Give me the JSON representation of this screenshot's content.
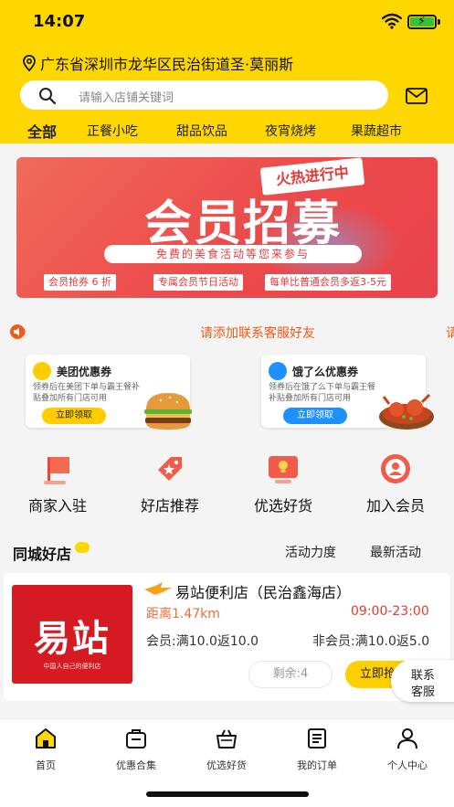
{
  "status_bar": {
    "time": "14:07"
  },
  "location": "广东省深圳市龙华区民治街道圣·莫丽斯",
  "search": {
    "placeholder": "请输入店铺关键词"
  },
  "categories": [
    "全部",
    "正餐小吃",
    "甜品饮品",
    "夜宵烧烤",
    "果蔬超市"
  ],
  "banner": {
    "tag": "火热进行中",
    "title": "会员招募",
    "subtitle": "免费的美食活动等您来参与",
    "chips": [
      "会员抢券 6 折",
      "专属会员节日活动",
      "每单比普通会员多返3-5元"
    ]
  },
  "notice": {
    "text": "请添加联系客服好友",
    "overflow": "请"
  },
  "coupons": [
    {
      "title": "美团优惠券",
      "desc": "领券后在美团下单与霸王餐补贴叠加所有门店可用",
      "button": "立即领取",
      "color": "#ffcc00"
    },
    {
      "title": "饿了么优惠券",
      "desc": "领券后在饿了么下单与霸王餐补贴叠加所有门店可用",
      "button": "立即领取",
      "color": "#1e90ff"
    }
  ],
  "quick_actions": [
    {
      "label": "商家入驻",
      "icon": "flag-icon"
    },
    {
      "label": "好店推荐",
      "icon": "tag-star-icon"
    },
    {
      "label": "优选好货",
      "icon": "screen-bulb-icon"
    },
    {
      "label": "加入会员",
      "icon": "member-icon"
    }
  ],
  "section": {
    "title": "同城好店",
    "filters": [
      "活动力度",
      "最新活动"
    ]
  },
  "store": {
    "name": "易站便利店（民治鑫海店）",
    "image_text": "易站",
    "image_sub": "中国人自己的便利店",
    "distance": "距离1.47km",
    "hours": "09:00-23:00",
    "member": "会员:满10.0返10.0",
    "non_member": "非会员:满10.0返5.0",
    "remaining": "剩余:4",
    "grab": "立即抢"
  },
  "contact": {
    "line1": "联系",
    "line2": "客服"
  },
  "tabs": [
    {
      "label": "首页",
      "icon": "home-icon",
      "active": true
    },
    {
      "label": "优惠合集",
      "icon": "coupon-bag-icon"
    },
    {
      "label": "优选好货",
      "icon": "basket-icon"
    },
    {
      "label": "我的订单",
      "icon": "order-list-icon"
    },
    {
      "label": "个人中心",
      "icon": "person-icon"
    }
  ],
  "colors": {
    "brand_yellow": "#ffd700",
    "banner_red": "#ec4a4a",
    "accent_orange": "#f05a1a"
  }
}
